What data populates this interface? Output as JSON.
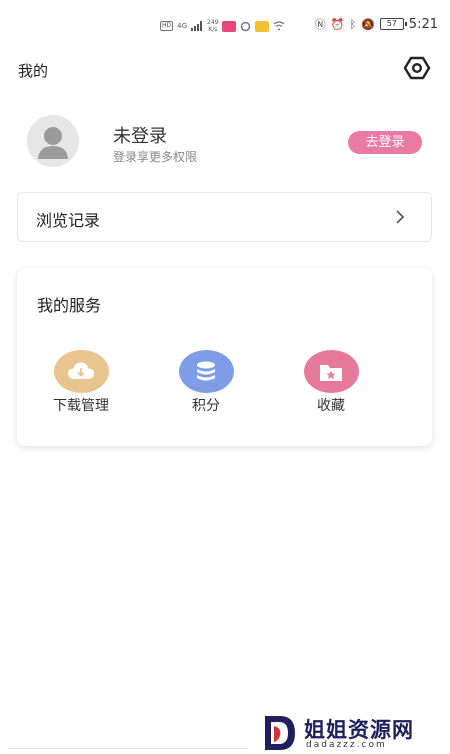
{
  "status_bar": {
    "network_badge": "HD",
    "signal_label": "4G",
    "speed_value": "249",
    "speed_unit": "K/s",
    "battery": "57",
    "time": "5:21"
  },
  "header": {
    "title": "我的"
  },
  "profile": {
    "username": "未登录",
    "hint": "登录享更多权限",
    "login_button": "去登录"
  },
  "history": {
    "label": "浏览记录"
  },
  "services": {
    "title": "我的服务",
    "items": [
      {
        "label": "下载管理",
        "icon": "cloud-download-icon",
        "color": "#e8c48e"
      },
      {
        "label": "积分",
        "icon": "coin-stack-icon",
        "color": "#7f9de6"
      },
      {
        "label": "收藏",
        "icon": "star-folder-icon",
        "color": "#e57a9c"
      }
    ]
  },
  "watermark": {
    "brand": "姐姐资源网",
    "url": "dadazzz.com"
  },
  "colors": {
    "accent": "#e97aa1"
  }
}
